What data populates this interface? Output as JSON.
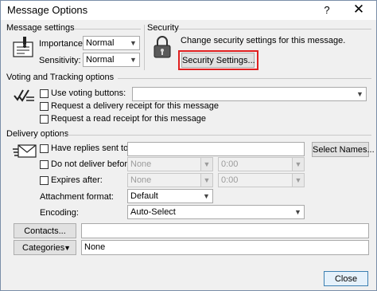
{
  "window": {
    "title": "Message Options",
    "help": "?",
    "close_symbol": "✕"
  },
  "message_settings": {
    "title": "Message settings",
    "importance_label": "Importance:",
    "importance_value": "Normal",
    "sensitivity_label": "Sensitivity:",
    "sensitivity_value": "Normal"
  },
  "security": {
    "title": "Security",
    "description": "Change security settings for this message.",
    "button_label": "Security Settings..."
  },
  "voting": {
    "title": "Voting and Tracking options",
    "use_voting_label": "Use voting buttons:",
    "delivery_receipt_label": "Request a delivery receipt for this message",
    "read_receipt_label": "Request a read receipt for this message"
  },
  "delivery": {
    "title": "Delivery options",
    "replies_label": "Have replies sent to:",
    "select_names_label": "Select Names...",
    "do_not_deliver_label": "Do not deliver before:",
    "do_not_deliver_date": "None",
    "do_not_deliver_time": "0:00",
    "expires_label": "Expires after:",
    "expires_date": "None",
    "expires_time": "0:00",
    "attachment_format_label": "Attachment format:",
    "attachment_format_value": "Default",
    "encoding_label": "Encoding:",
    "encoding_value": "Auto-Select"
  },
  "contacts": {
    "button_label": "Contacts..."
  },
  "categories": {
    "button_label": "Categories",
    "value": "None"
  },
  "footer": {
    "close_label": "Close"
  },
  "colors": {
    "highlight": "#e02020",
    "window_bg": "#f0f0f0"
  }
}
